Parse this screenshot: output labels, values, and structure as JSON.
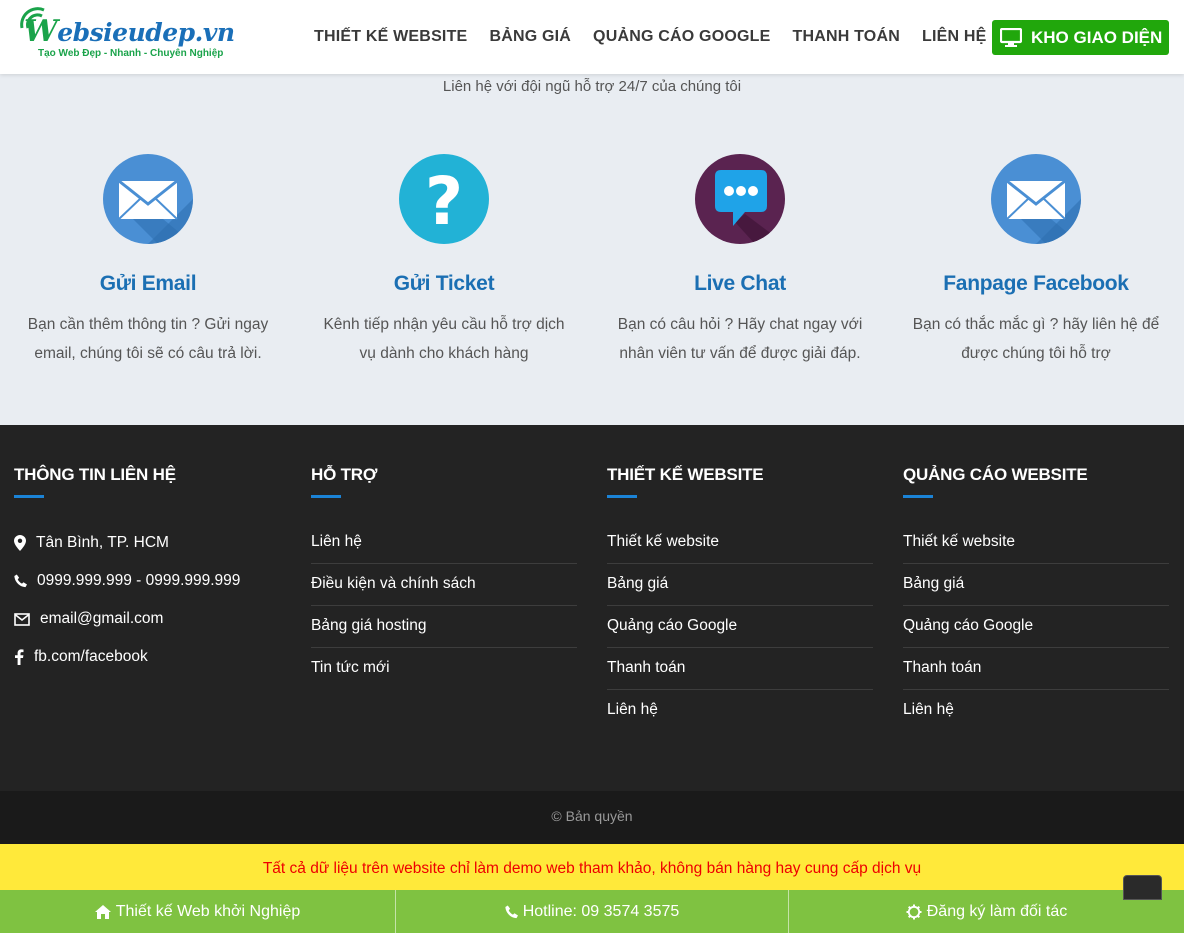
{
  "header": {
    "logo_text": "ebsieudep.vn",
    "logo_first_letter": "W",
    "logo_tagline": "Tạo Web Đẹp - Nhanh - Chuyên Nghiệp",
    "nav": [
      "THIẾT KẾ WEBSITE",
      "BẢNG GIÁ",
      "QUẢNG CÁO GOOGLE",
      "THANH TOÁN",
      "LIÊN HỆ"
    ],
    "cta_label": "KHO GIAO DIỆN",
    "cta_icon": "monitor-icon"
  },
  "intro": "Liên hệ với đội ngũ hỗ trợ 24/7 của chúng tôi",
  "support": [
    {
      "title": "Gửi Email",
      "desc": "Bạn cần thêm thông tin ? Gửi ngay email, chúng tôi sẽ có câu trả lời.",
      "icon": "envelope-icon",
      "color": "#4a90d9"
    },
    {
      "title": "Gửi Ticket",
      "desc": "Kênh tiếp nhận yêu cầu hỗ trợ dịch vụ dành cho khách hàng",
      "icon": "question-icon",
      "color": "#22b2d6"
    },
    {
      "title": "Live Chat",
      "desc": "Bạn có câu hỏi ? Hãy chat ngay với nhân viên tư vấn để được giải đáp.",
      "icon": "chat-bubble-icon",
      "color": "#5a2350"
    },
    {
      "title": "Fanpage Facebook",
      "desc": "Bạn có thắc mắc gì ? hãy liên hệ để được chúng tôi hỗ trợ",
      "icon": "envelope-icon",
      "color": "#4a90d9"
    }
  ],
  "footer": {
    "contact": {
      "heading": "THÔNG TIN LIÊN HỆ",
      "items": [
        {
          "icon": "map-pin-icon",
          "text": "Tân Bình, TP. HCM"
        },
        {
          "icon": "phone-icon",
          "text": "0999.999.999 - 0999.999.999"
        },
        {
          "icon": "envelope-icon",
          "text": "email@gmail.com"
        },
        {
          "icon": "facebook-icon",
          "text": "fb.com/facebook"
        }
      ]
    },
    "support": {
      "heading": "HỖ TRỢ",
      "links": [
        "Liên hệ",
        "Điều kiện và chính sách",
        "Bảng giá hosting",
        "Tin tức mới"
      ]
    },
    "design": {
      "heading": "THIẾT KẾ WEBSITE",
      "links": [
        "Thiết kế website",
        "Bảng giá",
        "Quảng cáo Google",
        "Thanh toán",
        "Liên hệ"
      ]
    },
    "ads": {
      "heading": "QUẢNG CÁO WEBSITE",
      "links": [
        "Thiết kế website",
        "Bảng giá",
        "Quảng cáo Google",
        "Thanh toán",
        "Liên hệ"
      ]
    }
  },
  "copyright": "© Bản quyền",
  "notice": "Tất cả dữ liệu trên website chỉ làm demo web tham khảo, không bán hàng hay cung cấp dịch vụ",
  "bottom_bar": [
    {
      "icon": "home-icon",
      "label": "Thiết kế Web khởi Nghiệp"
    },
    {
      "icon": "phone-icon",
      "label": "Hotline: 09 3574 3575"
    },
    {
      "icon": "gear-icon",
      "label": "Đăng ký làm đối tác"
    }
  ],
  "colors": {
    "accent_blue": "#1b6fb3",
    "cta_green": "#21a70c",
    "bottom_green": "#7fc241",
    "notice_yellow": "#ffe93a",
    "notice_red": "#e00000",
    "footer_bg": "#232323"
  }
}
